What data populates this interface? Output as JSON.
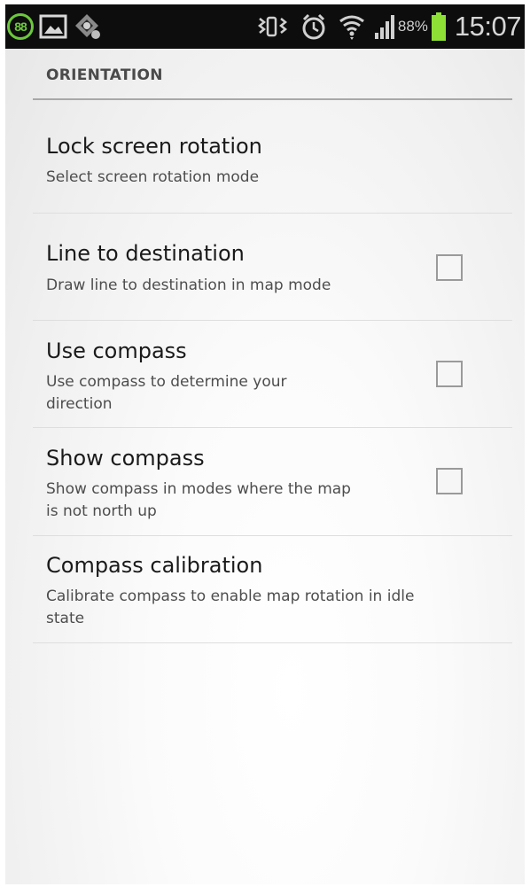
{
  "status_bar": {
    "notification_count": "88",
    "battery_percent": "88%",
    "time": "15:07",
    "icons": [
      "notification-count-badge",
      "gallery-icon",
      "app-icon",
      "nfc-vibrate-icon",
      "alarm-icon",
      "wifi-icon",
      "signal-icon",
      "battery-icon"
    ]
  },
  "section": {
    "title": "ORIENTATION"
  },
  "prefs": [
    {
      "title": "Lock screen rotation",
      "summary": "Select screen rotation mode",
      "has_checkbox": false
    },
    {
      "title": "Line to destination",
      "summary": "Draw line to destination in map mode",
      "has_checkbox": true,
      "checked": false
    },
    {
      "title": "Use compass",
      "summary_lines": [
        "Use compass to determine your",
        "direction"
      ],
      "has_checkbox": true,
      "checked": false
    },
    {
      "title": "Show compass",
      "summary_lines": [
        "Show compass in modes where the map",
        "is not north up"
      ],
      "has_checkbox": true,
      "checked": false
    },
    {
      "title": "Compass calibration",
      "summary_lines": [
        "Calibrate compass to enable map rotation in idle",
        "state"
      ],
      "has_checkbox": false
    }
  ],
  "colors": {
    "status_bar_bg": "#0d0d0d",
    "battery_green": "#8ee037",
    "badge_green": "#6cc83c",
    "divider": "#dedede",
    "header_divider": "#a8a8a8"
  }
}
